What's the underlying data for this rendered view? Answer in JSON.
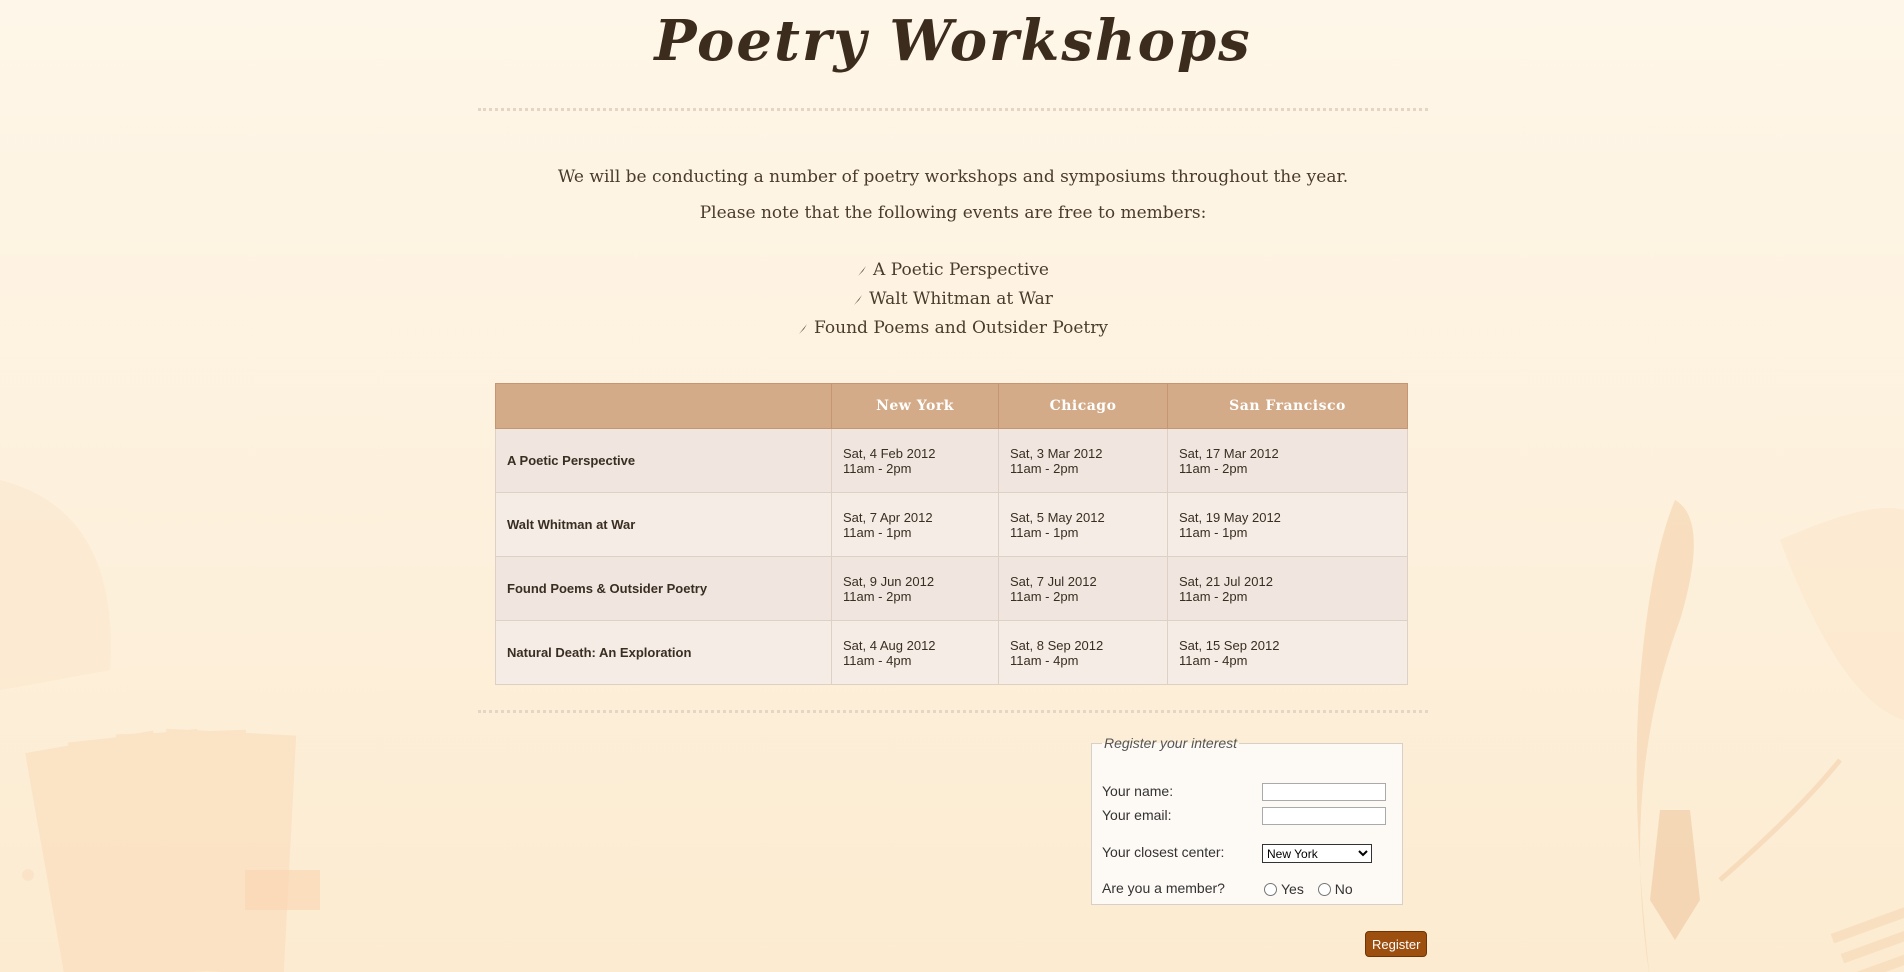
{
  "header": {
    "title": "Poetry Workshops"
  },
  "intro": {
    "line1": "We will be conducting a number of poetry workshops and symposiums throughout the year.",
    "line2": "Please note that the following events are free to members:"
  },
  "free_events": [
    "A Poetic Perspective",
    "Walt Whitman at War",
    "Found Poems and Outsider Poetry"
  ],
  "schedule": {
    "headers": [
      "",
      "New York",
      "Chicago",
      "San Francisco"
    ],
    "rows": [
      {
        "event": "A Poetic Perspective",
        "ny_date": "Sat, 4 Feb 2012",
        "ny_time": "11am - 2pm",
        "chi_date": "Sat, 3 Mar 2012",
        "chi_time": "11am - 2pm",
        "sf_date": "Sat, 17 Mar 2012",
        "sf_time": "11am - 2pm"
      },
      {
        "event": "Walt Whitman at War",
        "ny_date": "Sat, 7 Apr 2012",
        "ny_time": "11am - 1pm",
        "chi_date": "Sat, 5 May 2012",
        "chi_time": "11am - 1pm",
        "sf_date": "Sat, 19 May 2012",
        "sf_time": "11am - 1pm"
      },
      {
        "event": "Found Poems & Outsider Poetry",
        "ny_date": "Sat, 9 Jun 2012",
        "ny_time": "11am - 2pm",
        "chi_date": "Sat, 7 Jul 2012",
        "chi_time": "11am - 2pm",
        "sf_date": "Sat, 21 Jul 2012",
        "sf_time": "11am - 2pm"
      },
      {
        "event": "Natural Death: An Exploration",
        "ny_date": "Sat, 4 Aug 2012",
        "ny_time": "11am - 4pm",
        "chi_date": "Sat, 8 Sep 2012",
        "chi_time": "11am - 4pm",
        "sf_date": "Sat, 15 Sep 2012",
        "sf_time": "11am - 4pm"
      }
    ]
  },
  "form": {
    "legend": "Register your interest",
    "name_label": "Your name:",
    "name_value": "",
    "email_label": "Your email:",
    "email_value": "",
    "center_label": "Your closest center:",
    "center_selected": "New York",
    "member_label": "Are you a member?",
    "yes_label": "Yes",
    "no_label": "No",
    "submit_label": "Register"
  },
  "icons": {
    "list_bullet": "quill-icon",
    "background_left": "books-icon",
    "background_right": "quill-pen-icon"
  },
  "colors": {
    "background": "#fef6e8",
    "table_header": "#d4ab88",
    "row_odd": "#f0e6df",
    "row_even": "#f5ece5",
    "button": "#9c4f0e",
    "title_text": "#3b2c1e"
  }
}
